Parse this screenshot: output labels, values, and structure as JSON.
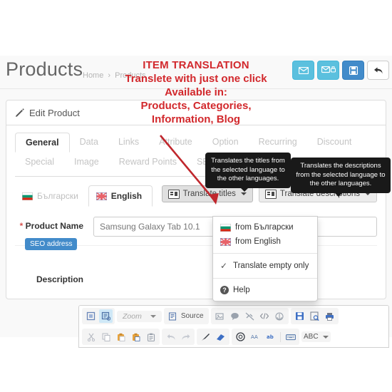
{
  "header": {
    "title": "Products",
    "breadcrumb": {
      "home": "Home",
      "separator": "›",
      "current": "Products"
    },
    "buttons": [
      {
        "name": "email-button",
        "icon": "envelope-icon"
      },
      {
        "name": "email-print-button",
        "icon": "envelope-print-icon"
      },
      {
        "name": "save-button",
        "icon": "floppy-save-icon"
      },
      {
        "name": "back-button",
        "icon": "back-arrow-icon"
      }
    ]
  },
  "panel": {
    "title": "Edit Product",
    "icon": "pencil-icon"
  },
  "tabs": {
    "row1": [
      "General",
      "Data",
      "Links",
      "Attribute",
      "Option",
      "Recurring",
      "Discount"
    ],
    "row2": [
      "Special",
      "Image",
      "Reward Points",
      "SEO"
    ],
    "active": "General"
  },
  "languages": [
    {
      "label": "Български",
      "flag": "bulgaria-flag-icon",
      "active": false
    },
    {
      "label": "English",
      "flag": "uk-flag-icon",
      "active": true
    }
  ],
  "translate_buttons": [
    {
      "label": "Translate titles",
      "icon": "translate-icon",
      "open": true
    },
    {
      "label": "Translate descriptions",
      "icon": "translate-icon",
      "open": false
    }
  ],
  "tooltips": {
    "titles": "Translates the titles from the selected language to the other languages.",
    "descriptions": "Translates the descriptions from the selected language to the other languages."
  },
  "dropdown": {
    "items": [
      {
        "label": "from Български",
        "icon": "bulgaria-flag-icon"
      },
      {
        "label": "from English",
        "icon": "uk-flag-icon"
      }
    ],
    "checkbox": {
      "label": "Translate empty only",
      "checked": true,
      "mark": "✓"
    },
    "help": {
      "label": "Help",
      "icon": "question-circle-icon"
    }
  },
  "form": {
    "product_name": {
      "label_required": "*",
      "label": "Product Name",
      "value": "Samsung Galaxy Tab 10.1",
      "badge": "SEO address"
    },
    "description": {
      "label": "Description"
    }
  },
  "editor": {
    "zoom_label": "Zoom",
    "source_label": "Source",
    "abc_label": "ABC"
  },
  "annotation": {
    "line1": "ITEM TRANSLATION",
    "line2": "Translete with just one click",
    "line3": "Available in:",
    "line4": "Products, Categories,",
    "line5": "Information, Blog",
    "color": "#d2282c"
  }
}
